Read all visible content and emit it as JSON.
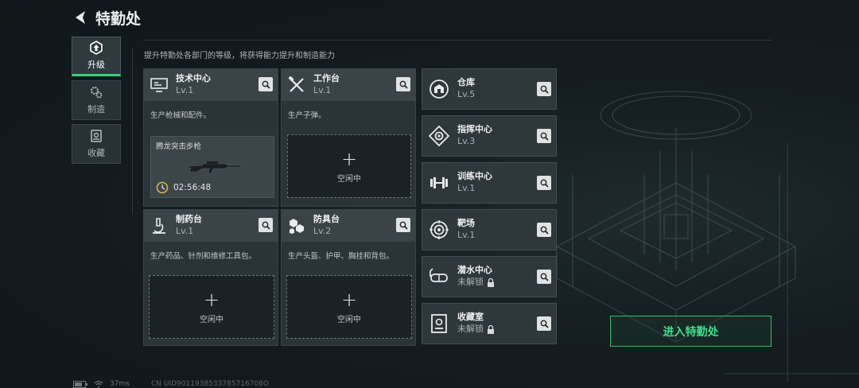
{
  "header": {
    "title": "特勤处"
  },
  "subtitle": "提升特勤处各部门的等级，将获得能力提升和制造能力",
  "nav": [
    {
      "label": "升级",
      "icon": "upgrade-icon",
      "active": true
    },
    {
      "label": "制造",
      "icon": "gears-icon",
      "active": false
    },
    {
      "label": "收藏",
      "icon": "collection-icon",
      "active": false
    }
  ],
  "stations": {
    "tech": {
      "name": "技术中心",
      "level": "Lv.1",
      "desc": "生产枪械和配件。",
      "producing": {
        "item": "腾龙突击步枪",
        "timer": "02:56:48"
      }
    },
    "workbench": {
      "name": "工作台",
      "level": "Lv.1",
      "desc": "生产子弹。",
      "idle": "空闲中"
    },
    "pharmacy": {
      "name": "制药台",
      "level": "Lv.1",
      "desc": "生产药品、针剂和维修工具包。",
      "idle": "空闲中"
    },
    "armor": {
      "name": "防具台",
      "level": "Lv.2",
      "desc": "生产头盔、护甲、胸挂和背包。",
      "idle": "空闲中"
    }
  },
  "departments": [
    {
      "name": "仓库",
      "level": "Lv.5",
      "icon": "warehouse-icon",
      "locked": false
    },
    {
      "name": "指挥中心",
      "level": "Lv.3",
      "icon": "command-center-icon",
      "locked": false
    },
    {
      "name": "训练中心",
      "level": "Lv.1",
      "icon": "dumbbell-icon",
      "locked": false
    },
    {
      "name": "靶场",
      "level": "Lv.1",
      "icon": "target-icon",
      "locked": false
    },
    {
      "name": "潜水中心",
      "level": "未解锁",
      "icon": "diving-mask-icon",
      "locked": true
    },
    {
      "name": "收藏室",
      "level": "未解锁",
      "icon": "collection-room-icon",
      "locked": true
    }
  ],
  "enter_button": "进入特勤处",
  "status": {
    "ping": "37ms",
    "uid": "CN UID9011938533785716708O"
  },
  "colors": {
    "accent": "#3de08a",
    "background": "#141b1f",
    "card": "#2a3337"
  }
}
